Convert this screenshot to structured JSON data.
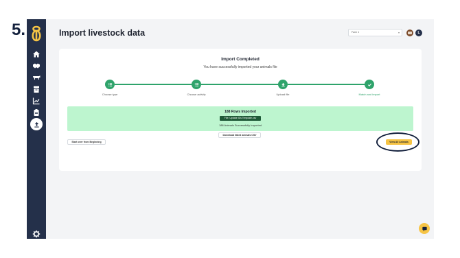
{
  "annotation": {
    "step_number": "5."
  },
  "header": {
    "title": "Import livestock data",
    "farm_select": "Farm 1",
    "user_initial": "L"
  },
  "sidebar": {
    "items": [
      {
        "icon": "home-icon"
      },
      {
        "icon": "handshake-icon"
      },
      {
        "icon": "cow-icon"
      },
      {
        "icon": "archive-icon"
      },
      {
        "icon": "chart-icon"
      },
      {
        "icon": "clipboard-icon"
      },
      {
        "icon": "upload-icon",
        "active": true
      }
    ],
    "settings_icon": "gear-icon"
  },
  "import": {
    "heading": "Import Completed",
    "subheading": "You have successfully imported your animals file",
    "steps": [
      {
        "label": "Choose type",
        "icon": "list-icon"
      },
      {
        "label": "Choose activity",
        "icon": "list-icon"
      },
      {
        "label": "Upload file",
        "icon": "upload-icon"
      },
      {
        "label": "Match and import",
        "icon": "check-icon"
      }
    ],
    "rows_imported": "188 Rows Imported",
    "file_name": "File: Update IDs Template.csv",
    "success_message": "188 Animals Successfully Imported",
    "download_failed_label": "Download failed animals CSV",
    "start_over_label": "Start over from Beginning",
    "view_all_label": "View All Animals"
  },
  "colors": {
    "sidebar": "#24304a",
    "accent_green": "#2fa36b",
    "banner_green": "#bdf5cf",
    "accent_yellow": "#f6c445"
  }
}
